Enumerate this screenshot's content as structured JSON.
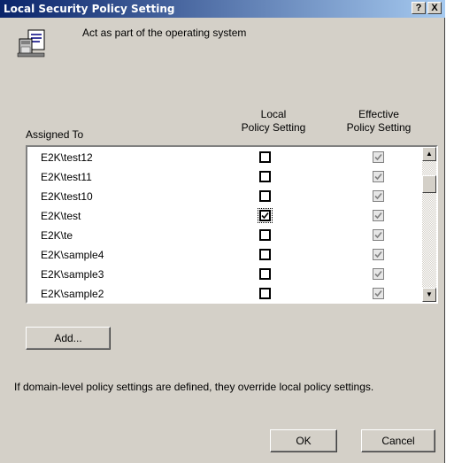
{
  "window": {
    "title": "Local Security Policy Setting",
    "help_label": "?",
    "close_label": "X"
  },
  "header": {
    "policy_icon": "policy-document-icon",
    "setting_name": "Act as part of the operating system"
  },
  "columns": {
    "assigned_to": "Assigned To",
    "local_line1": "Local",
    "local_line2": "Policy Setting",
    "effective_line1": "Effective",
    "effective_line2": "Policy Setting"
  },
  "rows": [
    {
      "user": "E2K\\test12",
      "local": false,
      "effective": true
    },
    {
      "user": "E2K\\test11",
      "local": false,
      "effective": true
    },
    {
      "user": "E2K\\test10",
      "local": false,
      "effective": true
    },
    {
      "user": "E2K\\test",
      "local": true,
      "effective": true
    },
    {
      "user": "E2K\\te",
      "local": false,
      "effective": true
    },
    {
      "user": "E2K\\sample4",
      "local": false,
      "effective": true
    },
    {
      "user": "E2K\\sample3",
      "local": false,
      "effective": true
    },
    {
      "user": "E2K\\sample2",
      "local": false,
      "effective": true
    }
  ],
  "buttons": {
    "add": "Add...",
    "ok": "OK",
    "cancel": "Cancel"
  },
  "note": "If domain-level policy settings are defined, they override local policy settings."
}
